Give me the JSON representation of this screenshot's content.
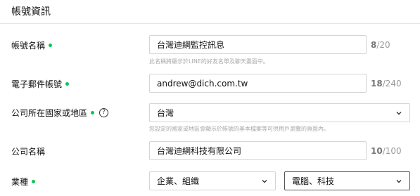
{
  "section": {
    "title": "帳號資訊"
  },
  "account_name": {
    "label": "帳號名稱",
    "value": "台灣迪網監控訊息",
    "count_current": "8",
    "count_max": "/20",
    "hint": "此名稱將顯示於LINE的好友名單及聊天畫面中。"
  },
  "email": {
    "label": "電子郵件帳號",
    "value": "andrew@dich.com.tw",
    "count_current": "18",
    "count_max": "/240"
  },
  "country": {
    "label": "公司所在國家或地區",
    "help_icon": "?",
    "value": "台灣",
    "hint": "您設定的國家或地區會顯示於帳號的基本檔案等可供用戶瀏覽的頁面內。"
  },
  "company": {
    "label": "公司名稱",
    "value": "台灣迪網科技有限公司",
    "count_current": "10",
    "count_max": "/100"
  },
  "industry": {
    "label": "業種",
    "category": "企業、組織",
    "subcategory": "電腦、科技"
  },
  "colors": {
    "required_dot": "#06c755",
    "border": "#d4d4d4",
    "hint": "#a8a8a8"
  },
  "icons": {
    "required": "required-dot",
    "help": "question-circle-icon",
    "dropdown": "chevron-down-icon"
  }
}
